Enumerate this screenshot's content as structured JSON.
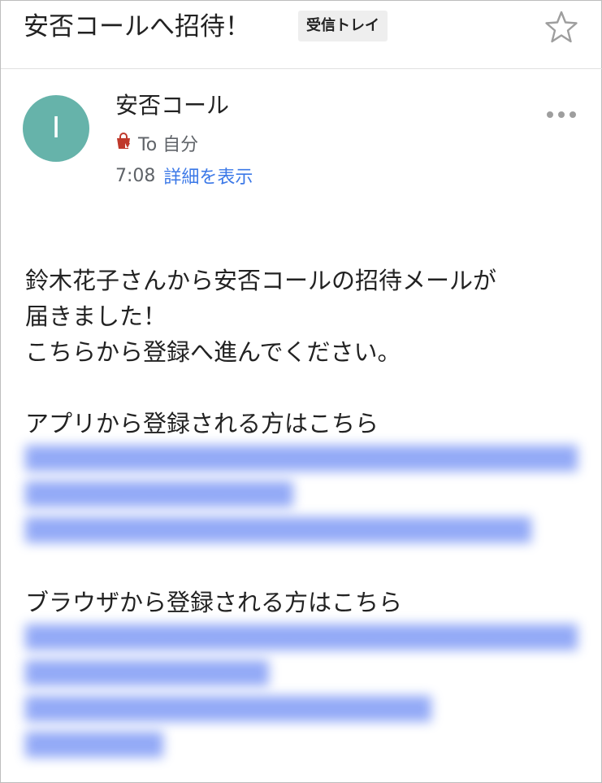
{
  "header": {
    "subject": "安否コールへ招待！",
    "label": "受信トレイ",
    "star_icon": "star-outline-icon"
  },
  "message": {
    "avatar_letter": "I",
    "avatar_color": "#66b3aa",
    "sender": "安否コール",
    "recipient": "To 自分",
    "recipient_icon": "bag-icon",
    "time": "7:08",
    "details_link": "詳細を表示",
    "more_icon": "more-horizontal-icon"
  },
  "body": {
    "line1": "鈴木花子さんから安否コールの招待メールが",
    "line2": "届きました！",
    "line3": "こちらから登録へ進んでください。",
    "app_heading": "アプリから登録される方はこちら",
    "browser_heading": "ブラウザから登録される方はこちら"
  },
  "colors": {
    "link": "#3b78e7",
    "bag_icon": "#c0392b"
  }
}
